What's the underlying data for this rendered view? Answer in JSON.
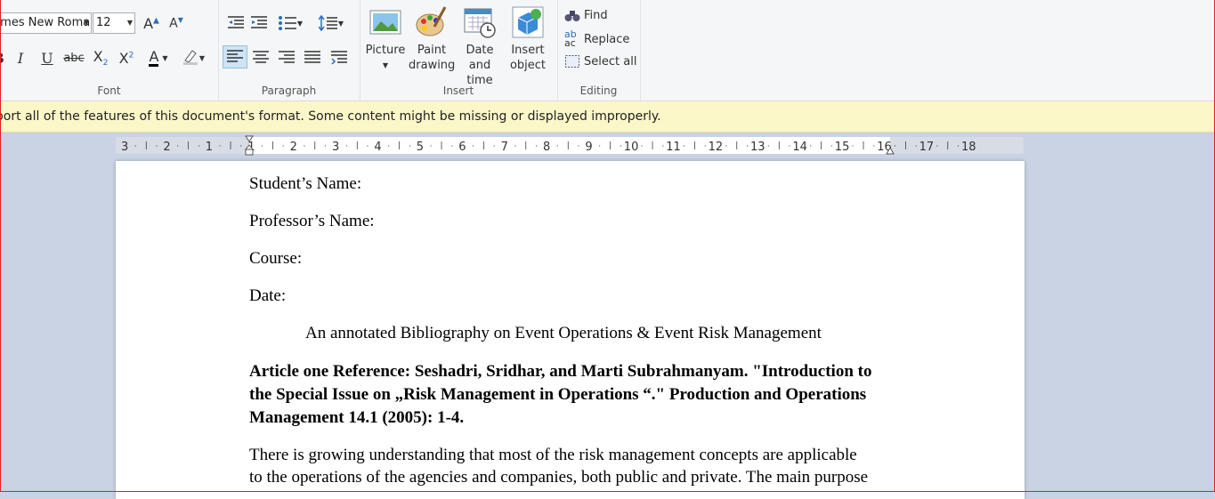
{
  "ribbon": {
    "font": {
      "family_value": "Times New Roma",
      "size_value": "12",
      "label": "Font"
    },
    "paragraph": {
      "label": "Paragraph"
    },
    "insert": {
      "label": "Insert",
      "picture": "Picture",
      "paint_line1": "Paint",
      "paint_line2": "drawing",
      "datetime_line1": "Date and",
      "datetime_line2": "time",
      "object_line1": "Insert",
      "object_line2": "object"
    },
    "editing": {
      "label": "Editing",
      "find": "Find",
      "replace": "Replace",
      "select_all": "Select all"
    }
  },
  "infobar": {
    "message": "pport all of the features of this document's format. Some content might be missing or displayed improperly."
  },
  "ruler": {
    "numbers": [
      "3",
      "2",
      "1",
      "1",
      "2",
      "3",
      "4",
      "5",
      "6",
      "7",
      "8",
      "9",
      "10",
      "11",
      "12",
      "13",
      "14",
      "15",
      "16",
      "17",
      "18"
    ]
  },
  "document": {
    "student": "Student’s Name:",
    "professor": "Professor’s Name:",
    "course": "Course:",
    "date": "Date:",
    "title": "An annotated Bibliography on Event Operations & Event Risk Management",
    "ref_line1": "Article one Reference: Seshadri, Sridhar, and Marti Subrahmanyam. \"Introduction to",
    "ref_line2": "the Special Issue on „Risk Management in Operations “.\" Production and Operations",
    "ref_line3": "Management 14.1 (2005): 1-4.",
    "body_line1": "There is growing understanding that most of the risk management concepts are applicable",
    "body_line2": "to the operations of the agencies and companies, both public and private. The main purpose"
  }
}
